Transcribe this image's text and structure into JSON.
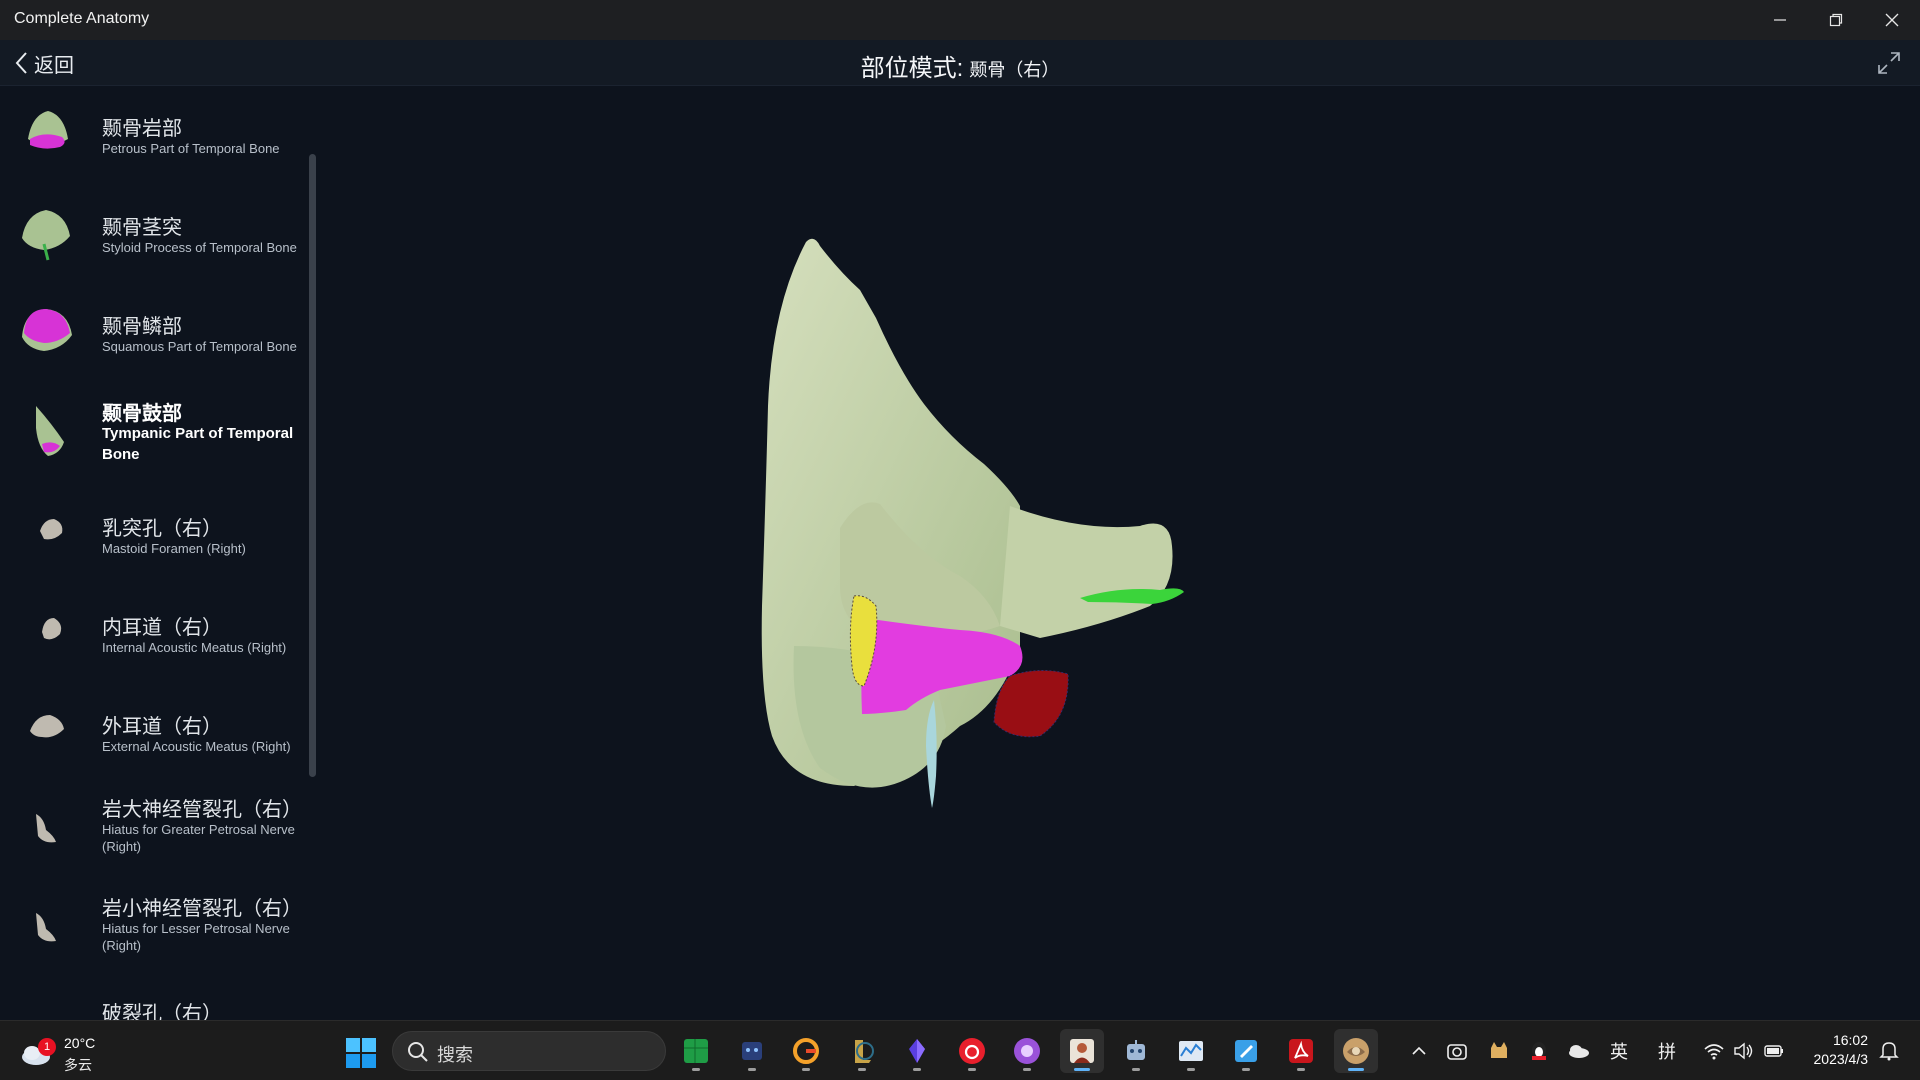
{
  "window": {
    "app_title": "Complete Anatomy",
    "minimize": "—",
    "restore": "❐",
    "close": "✕"
  },
  "header": {
    "back_label": "返回",
    "title": "部位模式:",
    "subtitle": "颞骨（右）"
  },
  "sidebar": {
    "items": [
      {
        "cn": "颞骨岩部",
        "en": "Petrous Part of Temporal Bone",
        "icon": "petrous-bone-icon"
      },
      {
        "cn": "颞骨茎突",
        "en": "Styloid Process of Temporal Bone",
        "icon": "styloid-process-icon"
      },
      {
        "cn": "颞骨鳞部",
        "en": "Squamous Part of Temporal Bone",
        "icon": "squamous-part-icon"
      },
      {
        "cn": "颞骨鼓部",
        "en": "Tympanic Part of Temporal Bone",
        "icon": "tympanic-part-icon",
        "active": true
      },
      {
        "cn": "乳突孔（右）",
        "en": "Mastoid Foramen (Right)",
        "icon": "mastoid-foramen-icon"
      },
      {
        "cn": "内耳道（右）",
        "en": "Internal Acoustic Meatus (Right)",
        "icon": "internal-acoustic-meatus-icon"
      },
      {
        "cn": "外耳道（右）",
        "en": "External Acoustic Meatus (Right)",
        "icon": "external-acoustic-meatus-icon"
      },
      {
        "cn": "岩大神经管裂孔（右）",
        "en": "Hiatus for Greater Petrosal Nerve (Right)",
        "icon": "greater-petrosal-hiatus-icon"
      },
      {
        "cn": "岩小神经管裂孔（右）",
        "en": "Hiatus for Lesser Petrosal Nerve (Right)",
        "icon": "lesser-petrosal-hiatus-icon"
      },
      {
        "cn": "破裂孔（右）",
        "en": "",
        "icon": "foramen-lacerum-icon"
      }
    ]
  },
  "taskbar": {
    "weather": {
      "badge": "1",
      "temp": "20°C",
      "desc": "多云"
    },
    "search_placeholder": "搜索",
    "apps": [
      "spreadsheet-app-icon",
      "cat-app-icon",
      "g-app-icon",
      "league-app-icon",
      "crystal-app-icon",
      "netease-music-icon",
      "purple-app-icon",
      "anatomy-person-icon",
      "robot-app-icon",
      "chart-app-icon",
      "docs-app-icon",
      "acrobat-icon",
      "complete-anatomy-icon"
    ],
    "tray": {
      "ime_lang": "英",
      "ime_mode": "拼"
    },
    "clock": {
      "time": "16:02",
      "date": "2023/4/3"
    }
  },
  "colors": {
    "background": "#0d131d",
    "bone": "#c6d3ab",
    "highlight_magenta": "#e23ce0",
    "yellow": "#e9df3d",
    "red": "#990e14",
    "green": "#3bd43b"
  }
}
